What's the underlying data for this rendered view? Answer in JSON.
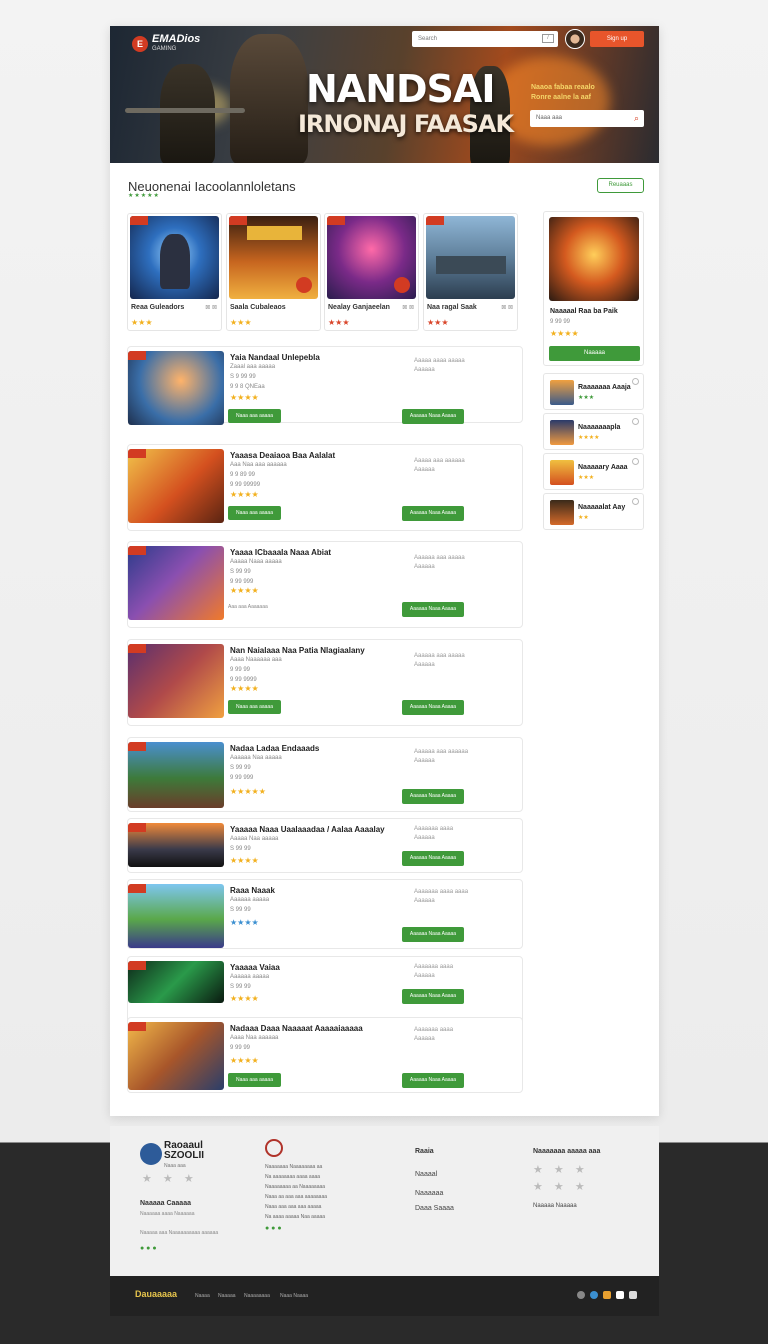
{
  "header": {
    "logo_mark": "E",
    "logo_text": "EMADios",
    "logo_sub": "GAMING",
    "top_search_placeholder": "Search",
    "kbd": "/",
    "signin_label": "Sign up",
    "hero_title": "NANDSAI",
    "hero_subtitle": "IRNONAJ FAASAK",
    "hero_tag_line1": "Naaoa fabaa reaalo",
    "hero_tag_line2": "Ronre aalne la aaf",
    "hero_search_placeholder": "Naaa aaa"
  },
  "section": {
    "title": "Neuonenai Iacoolannloletans",
    "stars": "★★★★★",
    "view_all": "Reuaaas"
  },
  "top_cards": [
    {
      "name": "Reaa Guleadors",
      "meta": "⊠ ⊠",
      "stars": "★★★"
    },
    {
      "name": "Saala Cubaleaos",
      "meta": "",
      "stars": "★★★"
    },
    {
      "name": "Nealay Ganjaeelan",
      "meta": "⊠ ⊠",
      "stars": "★★★"
    },
    {
      "name": "Naa ragal Saak",
      "meta": "⊠ ⊠",
      "stars": "★★★"
    }
  ],
  "list": [
    {
      "title": "Yaia Nandaal Unlepebla",
      "l1": "Zaaal aaa aaaaa",
      "l2": "S 9 99 99",
      "l3": "9 9 8 QNEaa",
      "stars": "★★★★",
      "right": "Aaaaa aaaa aaaaa\nAaaaaa",
      "btn_small": "Naaa aaa aaaaa",
      "btn_get": "Aaaaaa Naaa Aaaaa"
    },
    {
      "title": "Yaaasa Deaiaoa Baa Aalalat",
      "l1": "Aaa Naa aaa aaaaaa",
      "l2": "9 9 89 99",
      "l3": "9 99 99999",
      "stars": "★★★★",
      "right": "Aaaaa aaa aaaaaa\nAaaaaa",
      "btn_small": "Naaa aaa aaaaa",
      "btn_get": "Aaaaaa Naaa Aaaaa"
    },
    {
      "title": "Yaaaa ICbaaala Naaa Abiat",
      "l1": "Aaaaa Naaa aaaaa",
      "l2": "S 99 99",
      "l3": "9 99 999",
      "stars": "★★★★",
      "right": "Aaaaaa aaa aaaaa\nAaaaaa",
      "btn_small": "Aaa aaa Aaaaaaa",
      "btn_get": "Aaaaaa Naaa Aaaaa"
    },
    {
      "title": "Nan Naialaaa Naa Patia Nlagiaalany",
      "l1": "Aaaa Naaaaaa aaa",
      "l2": "9 99 99",
      "l3": "9 99 9999",
      "stars": "★★★★",
      "right": "Aaaaaa aaa aaaaa\nAaaaaa",
      "btn_small": "Naaa aaa aaaaa",
      "btn_get": "Aaaaaa Naaa Aaaaa"
    },
    {
      "title": "Nadaa Ladaa Endaaads",
      "l1": "Aaaaaa Naa aaaaa",
      "l2": "S 99 99",
      "l3": "9 99 999",
      "stars": "★★★★★",
      "right": "Aaaaaa aaa aaaaaa\nAaaaaa",
      "btn_small": "",
      "btn_get": "Aaaaaa Naaa Aaaaa"
    },
    {
      "title": "Yaaaaa Naaa Uaalaaadaa / Aalaa Aaaalay",
      "l1": "Aaaaa Naa aaaaa",
      "l2": "S 99 99",
      "l3": "",
      "stars": "★★★★",
      "right": "Aaaaaaa aaaa\nAaaaaa",
      "btn_small": "",
      "btn_get": "Aaaaaa Naaa Aaaaa"
    },
    {
      "title": "Raaa Naaak",
      "l1": "Aaaaaa aaaaa",
      "l2": "S 99 99",
      "l3": "",
      "stars": "★★★★",
      "right": "Aaaaaaa aaaa aaaa\nAaaaaa",
      "btn_small": "",
      "btn_get": "Aaaaaa Naaa Aaaaa"
    },
    {
      "title": "Yaaaaa Vaiaa",
      "l1": "Aaaaaa aaaaa",
      "l2": "S 99 99",
      "l3": "",
      "stars": "★★★★",
      "right": "Aaaaaaa aaaa\nAaaaaa",
      "btn_small": "",
      "btn_get": "Aaaaaa Naaa Aaaaa"
    },
    {
      "title": "Nadaaa Daaa Naaaaat Aaaaaiaaaaa",
      "l1": "Aaaa Naa aaaaaa",
      "l2": "9 99 99",
      "l3": "",
      "stars": "★★★★",
      "right": "Aaaaaaa aaaa\nAaaaaa",
      "btn_small": "Naaa aaa aaaaa",
      "btn_get": "Aaaaaa Naaa Aaaaa"
    }
  ],
  "sidebar": {
    "featured": {
      "name": "Naaaaal Raa ba Paik",
      "meta": "9 99 99",
      "stars": "★★★★",
      "btn": "Naaaaa"
    },
    "minis": [
      {
        "name": "Raaaaaaa Aaaja",
        "stars": "★★★"
      },
      {
        "name": "Naaaaaaapla",
        "stars": "★★★★"
      },
      {
        "name": "Naaaaary Aaaa",
        "stars": "★★★"
      },
      {
        "name": "Naaaaalat Aay",
        "stars": "★★"
      }
    ]
  },
  "footer": {
    "brand_line1": "Raoaaul",
    "brand_line2": "SZOOLII",
    "brand_sub": "Naaa aaa",
    "social_stars": "★ ★ ★",
    "col1_head": "Naaaaa Caaaaa",
    "col1_text": "Naaaaaa aaaa Naaaaaa",
    "col1_line": "Naaaaa aaa Naaaaaaaaaa aaaaaa",
    "col2_lines": [
      "Naaaaaaa Naaaaaaaa aa",
      "Na aaaaaaaa aaaa aaaa",
      "Naaaaaaaa aa Naaaaaaaa",
      "Naaa aa aaa aaa aaaaaaaa",
      "Naaa aaa aaa aaa aaaaa",
      "Na aaaa aaaaa Naa aaaaa"
    ],
    "col3_head": "Raaia",
    "col3_items": [
      "Naaaal",
      "Naaaaaa",
      "Daaa Saaaa"
    ],
    "col4_head": "Naaaaaaa aaaaa aaa",
    "col4_stars": "★ ★ ★",
    "col4_last": "Naaaaa Naaaaa"
  },
  "bottom": {
    "logo": "Dauaaaaa",
    "links": [
      "Naaaa",
      "Naaaaa",
      "Naaaaaaaa",
      "Naaa Naaaa"
    ]
  },
  "colors": {
    "accent": "#3f9a3a",
    "brand": "#e8552b",
    "star": "#f2b01e"
  }
}
